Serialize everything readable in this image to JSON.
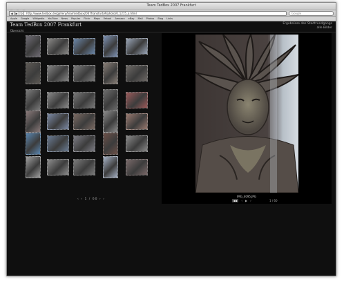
{
  "window": {
    "title": "Team TedBox 2007 Frankfurt"
  },
  "toolbar": {
    "back": "◀",
    "forward": "▶",
    "reload": "↻",
    "url": "http://www.tedbox.de/gallery/teamtedbox2007frankfurt/#/photo/0_1215_a.html",
    "search_placeholder": "Google"
  },
  "bookmarks": [
    "Apple",
    "Google",
    "Wikipedia",
    "YouTube",
    "News",
    "Popular",
    "Flickr",
    "Maps",
    "Yahoo!",
    "Amazon",
    "eBay",
    "Mail",
    "Photos",
    "Blog",
    "Links"
  ],
  "site": {
    "title": "Team TedBox 2007 Frankfurt",
    "header_right_1": "Ergebnisse des Stadtrundgangs",
    "header_right_2": "alle Bilder",
    "breadcrumb": "Übersicht"
  },
  "thumbnails": [
    {
      "color": "#6f6c74"
    },
    {
      "color": "#8b8a88"
    },
    {
      "color": "#6a86a8"
    },
    {
      "color": "#7e93b6"
    },
    {
      "color": "#9aa6b8"
    },
    {
      "color": "#5e5a55"
    },
    {
      "color": "#858585"
    },
    {
      "color": "#7a7a7a"
    },
    {
      "color": "#8a8078"
    },
    {
      "color": "#6e6a66"
    },
    {
      "color": "#7d7d7d"
    },
    {
      "color": "#8a8a8a"
    },
    {
      "color": "#787878"
    },
    {
      "color": "#6e6e6e"
    },
    {
      "color": "#9c5a5a"
    },
    {
      "color": "#8a7a7a"
    },
    {
      "color": "#7c8aa6"
    },
    {
      "color": "#7a6a62"
    },
    {
      "color": "#8c8c8c"
    },
    {
      "color": "#9a7a70"
    },
    {
      "color": "#5a86b0"
    },
    {
      "color": "#6a7c94"
    },
    {
      "color": "#7c7c84"
    },
    {
      "color": "#6c5048"
    },
    {
      "color": "#8a8a8a"
    },
    {
      "color": "#a0a0a0"
    },
    {
      "color": "#8e8e8e"
    },
    {
      "color": "#7c7c7c"
    },
    {
      "color": "#a8b4c8"
    },
    {
      "color": "#7a6a6a"
    }
  ],
  "pager": {
    "text": "‹ ‹ 1 / 60 › ›"
  },
  "viewer": {
    "caption": "IMG_4095.JPG",
    "controls": [
      "▪▪",
      "‹",
      "▶",
      "›"
    ],
    "counter": "1 / 60"
  }
}
